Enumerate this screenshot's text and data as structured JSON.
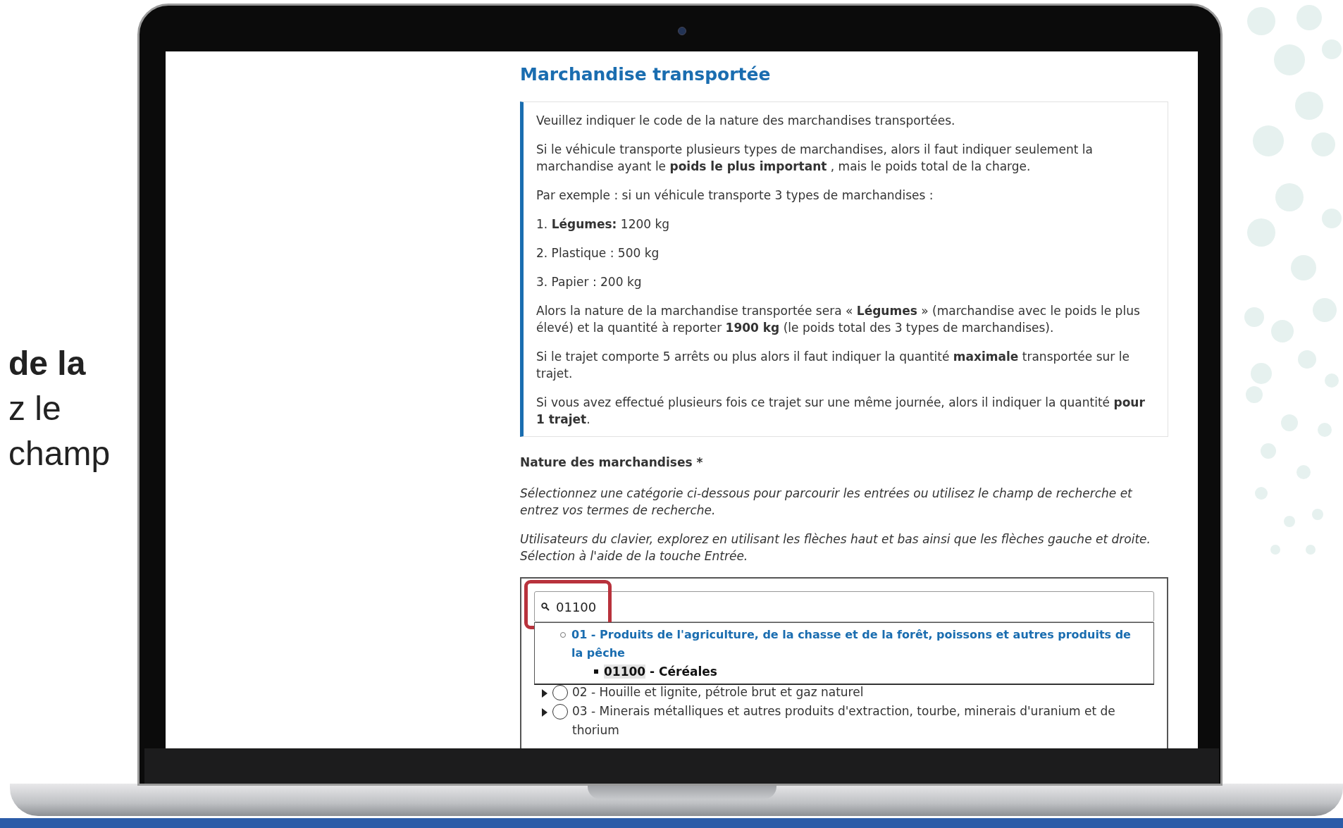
{
  "caption": {
    "lines": [
      {
        "text": "de la",
        "bold": true
      },
      {
        "text": "z le",
        "bold": false
      },
      {
        "text": "champ",
        "bold": false
      }
    ]
  },
  "page": {
    "title": "Marchandise transportée",
    "info": [
      "Veuillez indiquer le code de la nature des marchandises transportées.",
      "Si le véhicule transporte plusieurs types de marchandises, alors il faut indiquer seulement la marchandise ayant le **poids le plus important** , mais le poids total de la charge.",
      "Par exemple : si un véhicule transporte 3 types de marchandises :",
      "1. **Légumes:** 1200 kg",
      "2. Plastique : 500 kg",
      "3. Papier : 200 kg",
      "Alors la nature de la marchandise transportée sera « **Légumes** » (marchandise avec le poids le plus élevé) et la quantité à reporter **1900 kg** (le poids total des 3 types de marchandises).",
      "Si le trajet comporte 5 arrêts ou plus alors il faut indiquer la quantité **maximale** transportée sur le trajet.",
      "Si vous avez effectué plusieurs fois ce trajet sur une même journée, alors il indiquer la quantité **pour 1 trajet**."
    ],
    "field_label": "Nature des marchandises *",
    "hints": [
      "Sélectionnez une catégorie ci-dessous pour parcourir les entrées ou utilisez le champ de recherche et entrez vos termes de recherche.",
      "Utilisateurs du clavier, explorez en utilisant les flèches haut et bas ainsi que les flèches gauche et droite. Sélection à l'aide de la touche Entrée."
    ],
    "search": {
      "value": "01100",
      "highlighted": true
    },
    "suggestions": [
      {
        "text": "01 - Produits de l'agriculture, de la chasse et de la forêt, poissons et autres produits de la pêche",
        "children": [
          {
            "match": "01100",
            "rest": " - Céréales"
          }
        ]
      }
    ],
    "tree": [
      {
        "text": "02 - Houille et lignite, pétrole brut et gaz naturel",
        "expanded": false,
        "checked": false
      },
      {
        "text": "03 - Minerais métalliques et autres produits d'extraction, tourbe, minerais d'uranium et de thorium",
        "expanded": false,
        "checked": false
      }
    ]
  }
}
